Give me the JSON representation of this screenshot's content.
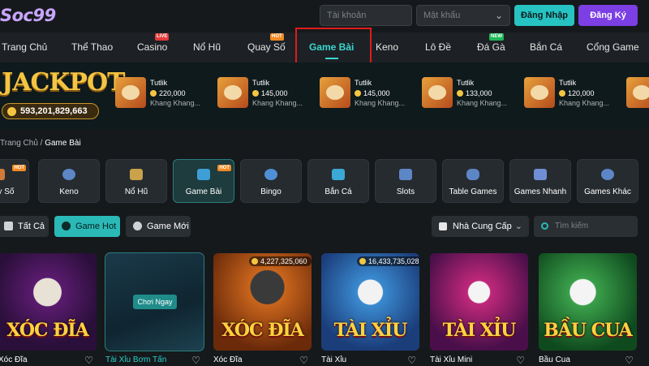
{
  "header": {
    "logo": "Soc99",
    "username_placeholder": "Tài khoản",
    "password_placeholder": "Mật khẩu",
    "login_label": "Đăng Nhập",
    "register_label": "Đăng Ký"
  },
  "nav": {
    "items": [
      {
        "label": "Trang Chủ",
        "badge": ""
      },
      {
        "label": "Thể Thao",
        "badge": ""
      },
      {
        "label": "Casino",
        "badge": "LIVE"
      },
      {
        "label": "Nổ Hũ",
        "badge": ""
      },
      {
        "label": "Quay Số",
        "badge": "HOT"
      },
      {
        "label": "Game Bài",
        "badge": "",
        "active": true
      },
      {
        "label": "Keno",
        "badge": ""
      },
      {
        "label": "Lô Đề",
        "badge": ""
      },
      {
        "label": "Đá Gà",
        "badge": "NEW"
      },
      {
        "label": "Bắn Cá",
        "badge": ""
      },
      {
        "label": "Cổng Game",
        "badge": ""
      }
    ]
  },
  "jackpot": {
    "title": "JACKPOT",
    "amount": "593,201,829,663",
    "winners": [
      {
        "name": "Tutlik",
        "amount": "220,000",
        "game": "Khang Khang..."
      },
      {
        "name": "Tutlik",
        "amount": "145,000",
        "game": "Khang Khang..."
      },
      {
        "name": "Tutlik",
        "amount": "145,000",
        "game": "Khang Khang..."
      },
      {
        "name": "Tutlik",
        "amount": "133,000",
        "game": "Khang Khang..."
      },
      {
        "name": "Tutlik",
        "amount": "120,000",
        "game": "Khang Khang..."
      }
    ]
  },
  "breadcrumb": {
    "home": "Trang Chủ",
    "separator": "/",
    "current": "Game Bài"
  },
  "categories": [
    {
      "label": "Quay Số",
      "badge": "HOT"
    },
    {
      "label": "Keno",
      "badge": ""
    },
    {
      "label": "Nổ Hũ",
      "badge": ""
    },
    {
      "label": "Game Bài",
      "badge": "HOT",
      "active": true
    },
    {
      "label": "Bingo",
      "badge": ""
    },
    {
      "label": "Bắn Cá",
      "badge": ""
    },
    {
      "label": "Slots",
      "badge": ""
    },
    {
      "label": "Table Games",
      "badge": ""
    },
    {
      "label": "Games Nhanh",
      "badge": ""
    },
    {
      "label": "Games Khác",
      "badge": ""
    }
  ],
  "filters": {
    "all": "Tất Cả",
    "hot": "Game Hot",
    "new": "Game Mới",
    "provider": "Nhà Cung Cấp",
    "search_placeholder": "Tìm kiếm"
  },
  "games": [
    {
      "name": "Xóc Đĩa",
      "art": "XÓC ĐĨA",
      "jackpot": ""
    },
    {
      "name": "Tài Xỉu Bơm Tấn",
      "art": "",
      "jackpot": "",
      "play_label": "Chơi Ngay",
      "highlighted": true
    },
    {
      "name": "Xóc Đĩa",
      "art": "XÓC ĐĨA",
      "jackpot": "4,227,325,060"
    },
    {
      "name": "Tài Xỉu",
      "art": "TÀI XỈU",
      "jackpot": "16,433,735,028"
    },
    {
      "name": "Tài Xỉu Mini",
      "art": "TÀI XỈU",
      "jackpot": ""
    },
    {
      "name": "Bầu Cua",
      "art": "BẦU CUA",
      "jackpot": ""
    }
  ],
  "colors": {
    "accent": "#2ab9b6",
    "brand": "#7b3fe4",
    "highlight_box": "#e01b1b"
  }
}
